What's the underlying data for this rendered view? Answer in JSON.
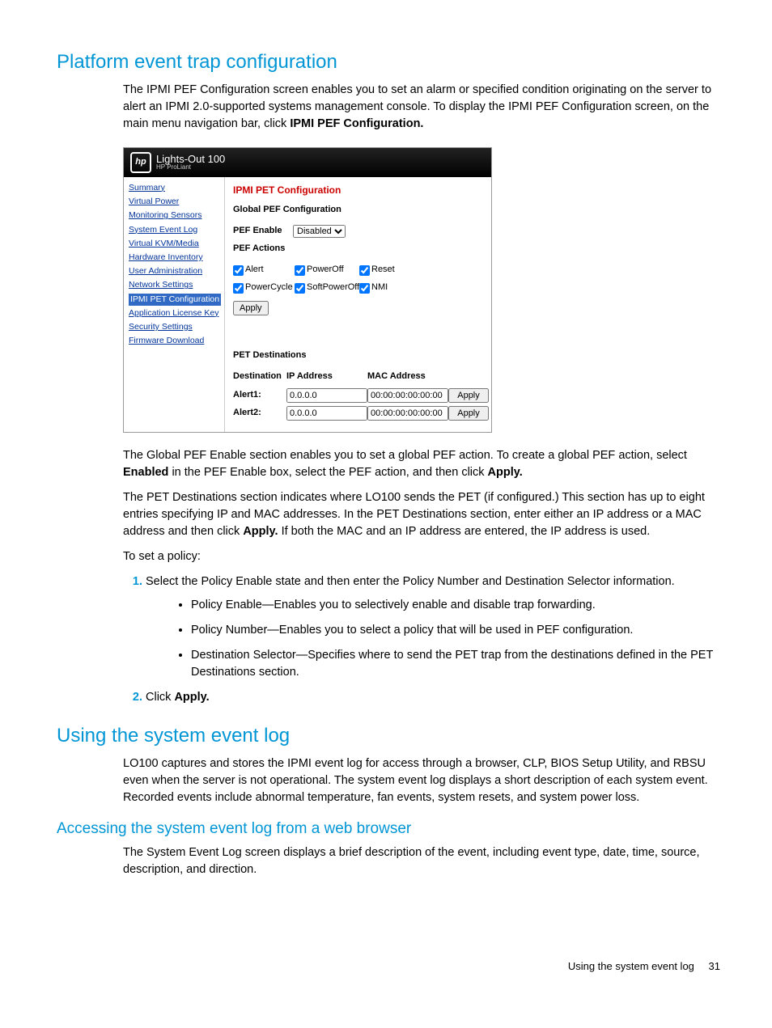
{
  "h1_a": "Platform event trap configuration",
  "p_a1a": "The IPMI PEF Configuration screen enables you to set an alarm or specified condition originating on the server to alert an IPMI 2.0-supported systems management console. To display the IPMI PEF Configuration screen, on the main menu navigation bar, click ",
  "p_a1b": "IPMI PEF Configuration.",
  "shot": {
    "brand_top": "Lights-Out 100",
    "brand_sub": "HP ProLiant",
    "nav": [
      "Summary",
      "Virtual Power",
      "Monitoring Sensors",
      "System Event Log",
      "Virtual KVM/Media",
      "Hardware Inventory",
      "User Administration",
      "Network Settings",
      "IPMI PET Configuration",
      "Application License Key",
      "Security Settings",
      "Firmware Download"
    ],
    "nav_active_index": 8,
    "title": "IPMI PET Configuration",
    "section1": "Global PEF Configuration",
    "pef_enable_label": "PEF Enable",
    "pef_enable_value": "Disabled",
    "pef_actions_label": "PEF Actions",
    "actions": [
      "Alert",
      "PowerOff",
      "Reset",
      "PowerCycle",
      "SoftPowerOff",
      "NMI"
    ],
    "apply": "Apply",
    "section2": "PET Destinations",
    "dest_head": [
      "Destination",
      "IP Address",
      "MAC Address",
      ""
    ],
    "dest_rows": [
      {
        "label": "Alert1:",
        "ip": "0.0.0.0",
        "mac": "00:00:00:00:00:00"
      },
      {
        "label": "Alert2:",
        "ip": "0.0.0.0",
        "mac": "00:00:00:00:00:00"
      }
    ]
  },
  "p_b1a": "The Global PEF Enable section enables you to set a global PEF action. To create a global PEF action, select ",
  "p_b1b": "Enabled",
  "p_b1c": " in the PEF Enable box, select the PEF action, and then click ",
  "p_b1d": "Apply.",
  "p_b2a": "The PET Destinations section indicates where LO100 sends the PET (if configured.) This section has up to eight entries specifying IP and MAC addresses. In the PET Destinations section, enter either an IP address or a MAC address and then click ",
  "p_b2b": "Apply.",
  "p_b2c": " If both the MAC and an IP address are entered, the IP address is used.",
  "p_b3": "To set a policy:",
  "li1": "Select the Policy Enable state and then enter the Policy Number and Destination Selector information.",
  "li1a": "Policy Enable—Enables you to selectively enable and disable trap forwarding.",
  "li1b": "Policy Number—Enables you to select a policy that will be used in PEF configuration.",
  "li1c": "Destination Selector—Specifies where to send the PET trap from the destinations defined in the PET Destinations section.",
  "li2a": "Click ",
  "li2b": "Apply.",
  "h1_b": "Using the system event log",
  "p_c1": "LO100 captures and stores the IPMI event log for access through a browser, CLP, BIOS Setup Utility, and RBSU even when the server is not operational. The system event log displays a short description of each system event. Recorded events include abnormal temperature, fan events, system resets, and system power loss.",
  "h2_a": "Accessing the system event log from a web browser",
  "p_d1": "The System Event Log screen displays a brief description of the event, including event type, date, time, source, description, and direction.",
  "footer_text": "Using the system event log",
  "footer_page": "31"
}
